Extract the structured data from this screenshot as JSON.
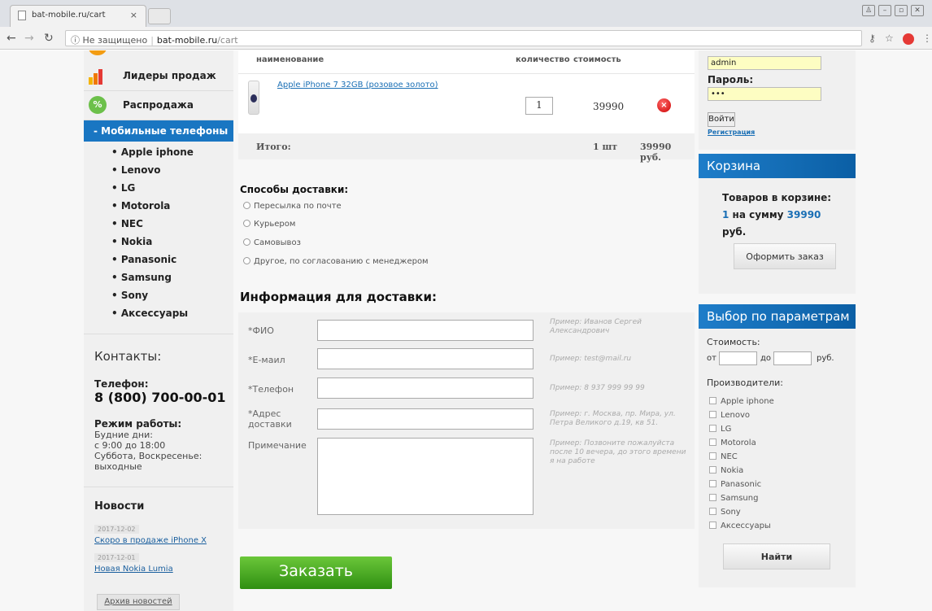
{
  "browser": {
    "tab_title": "bat-mobile.ru/cart",
    "tab_close": "×",
    "security": "Не защищено",
    "host": "bat-mobile.ru",
    "path": "/cart"
  },
  "left_menu": {
    "leaders": "Лидеры продаж",
    "sale": "Распродажа",
    "sale_icon_text": "%",
    "active_category": "- Мобильные телефоны",
    "brands": [
      "Apple iphone",
      "Lenovo",
      "LG",
      "Motorola",
      "NEC",
      "Nokia",
      "Panasonic",
      "Samsung",
      "Sony",
      "Аксессуары"
    ]
  },
  "contacts": {
    "title": "Контакты:",
    "phone_label": "Телефон:",
    "phone": "8 (800) 700-00-01",
    "hours_label": "Режим работы:",
    "hours_line1": "Будние дни:",
    "hours_line2": "с 9:00 до 18:00",
    "hours_line3": "Суббота, Воскресенье:",
    "hours_line4": "выходные"
  },
  "news": {
    "title": "Новости",
    "items": [
      {
        "date": "2017-12-02",
        "title": "Скоро в продаже iPhone X"
      },
      {
        "date": "2017-12-01",
        "title": "Новая Nokia Lumia"
      }
    ],
    "archive": "Архив новостей"
  },
  "cart": {
    "headers": {
      "name": "наименование",
      "qty": "количество",
      "cost": "стоимость"
    },
    "items": [
      {
        "name": "Apple iPhone 7 32GB (розовое золото)",
        "qty": "1",
        "price": "39990"
      }
    ],
    "remove_icon": "×",
    "total_label": "Итого:",
    "total_qty": "1 шт",
    "total_sum": "39990 руб."
  },
  "delivery": {
    "title": "Способы доставки:",
    "options": [
      "Пересылка по почте",
      "Курьером",
      "Самовывоз",
      "Другое, по согласованию с менеджером"
    ]
  },
  "info": {
    "title": "Информация для доставки:",
    "fields": [
      {
        "label": "*ФИО",
        "hint": "Пример: Иванов Сергей Александрович"
      },
      {
        "label": "*Е-мaил",
        "hint": "Пример: test@mail.ru"
      },
      {
        "label": "*Телефон",
        "hint": "Пример: 8 937 999 99 99"
      },
      {
        "label": "*Адрес доставки",
        "hint": "Пример: г. Москва, пр. Мира, ул. Петра Великого д.19, кв 51."
      },
      {
        "label": "Примечание",
        "hint": "Пример: Позвоните пожалуйста после 10 вечера, до этого времени я на работе"
      }
    ],
    "submit": "Заказать"
  },
  "login": {
    "login_value": "admin",
    "password_label": "Пароль:",
    "password_value": "•••",
    "submit": "Войти",
    "register": "Регистрация"
  },
  "cart_box": {
    "title": "Корзина",
    "line1": "Товаров в корзине:",
    "count": "1",
    "mid": " на сумму ",
    "sum": "39990",
    "currency": "руб.",
    "checkout": "Оформить заказ"
  },
  "filter": {
    "title": "Выбор по параметрам",
    "cost_label": "Стоимость:",
    "from": "от",
    "to": "до",
    "currency": "руб.",
    "makers_label": "Производители:",
    "makers": [
      "Apple iphone",
      "Lenovo",
      "LG",
      "Motorola",
      "NEC",
      "Nokia",
      "Panasonic",
      "Samsung",
      "Sony",
      "Аксессуары"
    ],
    "submit": "Найти"
  },
  "colors": {
    "accent_blue": "#1976c2",
    "order_green": "#3a9a1c",
    "remove_red": "#d32f2f"
  }
}
